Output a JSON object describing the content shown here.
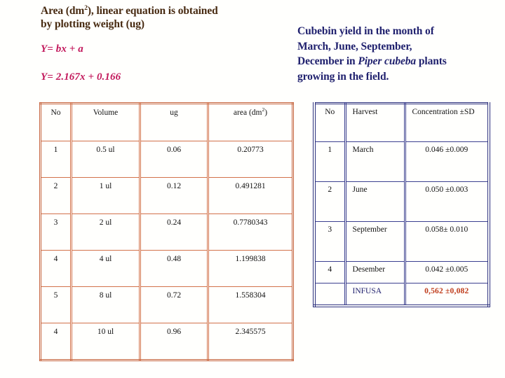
{
  "slide": {
    "background_color": "#fffffd"
  },
  "left_heading": {
    "color": "#472a11",
    "line1_a": "Area (dm",
    "line1_sup": "2",
    "line1_b": "), linear equation is obtained",
    "line2": "by plotting weight (ug)",
    "equation_color": "#c2185b",
    "equation_general": "Y= bx + a",
    "equation_fitted": "Y= 2.167x + 0.166"
  },
  "right_heading": {
    "color": "#20216e",
    "line1": "Cubebin yield in the month of",
    "line2": "March, June, September,",
    "line3_a": "December  in ",
    "line3_italic": "Piper cubeba",
    "line3_b": " plants",
    "line4": "growing in the field."
  },
  "table_area": {
    "border_color": "#c4613a",
    "headers": [
      "No",
      "Volume",
      "ug",
      "area (dm"
    ],
    "header_area_sup": "2",
    "header_area_suffix": ")",
    "rows": [
      {
        "no": "1",
        "volume": "0.5 ul",
        "ug": "0.06",
        "area": "0.20773"
      },
      {
        "no": "2",
        "volume": "1 ul",
        "ug": "0.12",
        "area": "0.491281"
      },
      {
        "no": "3",
        "volume": "2 ul",
        "ug": "0.24",
        "area": "0.7780343"
      },
      {
        "no": "4",
        "volume": "4 ul",
        "ug": "0.48",
        "area": "1.199838"
      },
      {
        "no": "5",
        "volume": "8 ul",
        "ug": "0.72",
        "area": "1.558304"
      },
      {
        "no": "4",
        "volume": "10 ul",
        "ug": "0.96",
        "area": "2.345575"
      }
    ]
  },
  "table_yield": {
    "border_color": "#2b2f7d",
    "headers": [
      "No",
      "Harvest",
      "Concentration ±SD"
    ],
    "rows": [
      {
        "no": "1",
        "harvest": "March",
        "concentration": "0.046 ±0.009"
      },
      {
        "no": "2",
        "harvest": "June",
        "concentration": "0.050 ±0.003"
      },
      {
        "no": "3",
        "harvest": "September",
        "concentration": "0.058± 0.010"
      },
      {
        "no": "4",
        "harvest": "Desember",
        "concentration": "0.042 ±0.005"
      }
    ],
    "infusa": {
      "no": "",
      "harvest": "INFUSA",
      "harvest_color": "#20216e",
      "concentration": "0,562 ±0,082",
      "concentration_color": "#bf3b1a"
    }
  }
}
